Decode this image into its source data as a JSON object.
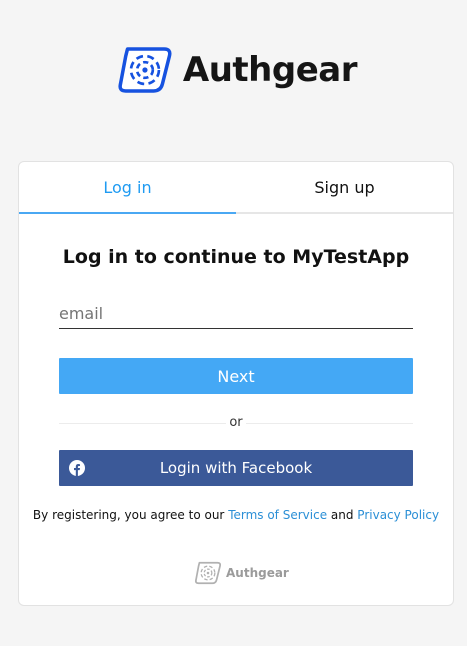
{
  "brand": {
    "name": "Authgear"
  },
  "tabs": {
    "login": "Log in",
    "signup": "Sign up"
  },
  "form": {
    "title": "Log in to continue to MyTestApp",
    "email_placeholder": "email",
    "next_label": "Next",
    "divider_text": "or",
    "facebook_label": "Login with Facebook"
  },
  "legal": {
    "prefix": "By registering, you agree to our ",
    "terms_label": "Terms of Service",
    "and": " and ",
    "privacy_label": "Privacy Policy"
  },
  "footer": {
    "brand_name": "Authgear"
  },
  "colors": {
    "accent": "#44a8f5",
    "facebook": "#3b5998",
    "link": "#2b8fd6"
  },
  "icons": {
    "logo": "authgear-logo-icon",
    "facebook": "facebook-icon"
  }
}
